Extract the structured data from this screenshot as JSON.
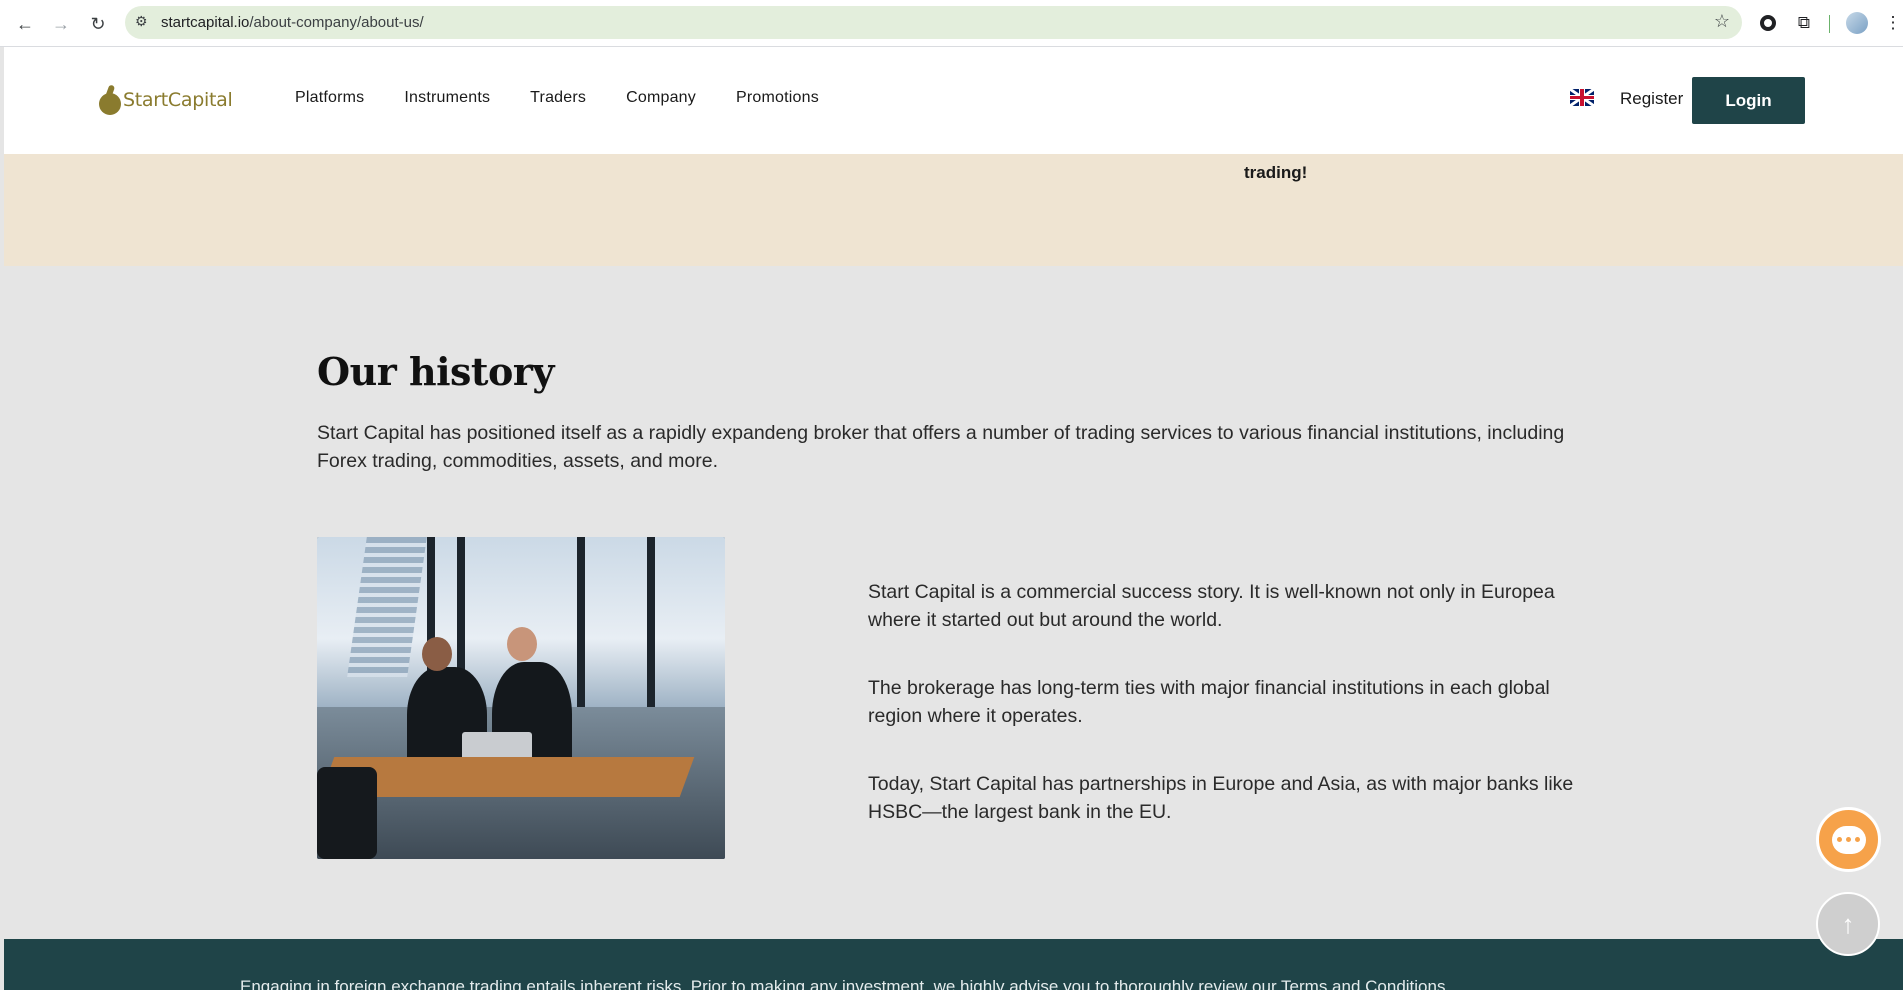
{
  "browser": {
    "url_host": "startcapital.io",
    "url_path": "/about-company/about-us/"
  },
  "header": {
    "logo_text": "StartCapital",
    "nav": [
      "Platforms",
      "Instruments",
      "Traders",
      "Company",
      "Promotions"
    ],
    "register_label": "Register",
    "login_label": "Login"
  },
  "hero_tail": {
    "text": "trading!"
  },
  "history": {
    "title": "Our history",
    "intro": "Start Capital has positioned itself as a rapidly expandeng broker that offers a number of trading services to various financial institutions, including Forex trading, commodities, assets, and more.",
    "paragraphs": [
      "Start Capital is a commercial success story. It is well-known not only in Europea where it started out but around the world.",
      "The brokerage has long-term ties with major financial institutions in each global region where it operates.",
      "Today, Start Capital has partnerships in Europe and Asia, as with major banks like HSBC—the largest bank in the EU."
    ]
  },
  "footer": {
    "risk_text": "Engaging in foreign exchange trading entails inherent risks. Prior to making any investment, we highly advise you to thoroughly review our Terms and Conditions."
  },
  "colors": {
    "brand_dark": "#1f4448",
    "logo_gold": "#8a7b2e",
    "beige_band": "#efe4d2",
    "chat_orange": "#f6a24a"
  }
}
